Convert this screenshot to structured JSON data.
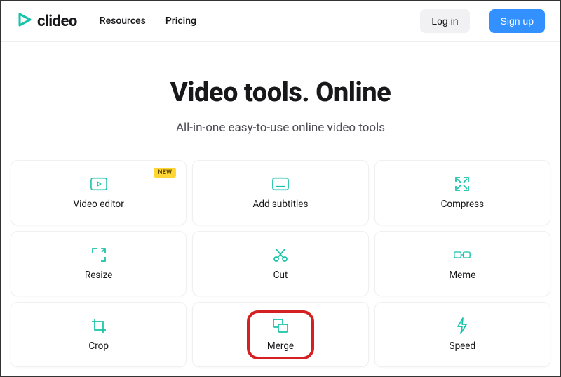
{
  "header": {
    "brand": "clideo",
    "nav": [
      "Resources",
      "Pricing"
    ],
    "login": "Log in",
    "signup": "Sign up"
  },
  "hero": {
    "title": "Video tools. Online",
    "subtitle": "All-in-one easy-to-use online video tools"
  },
  "badges": {
    "new": "NEW"
  },
  "tools": [
    {
      "label": "Video editor",
      "id": "video-editor",
      "new": true
    },
    {
      "label": "Add subtitles",
      "id": "add-subtitles"
    },
    {
      "label": "Compress",
      "id": "compress"
    },
    {
      "label": "Resize",
      "id": "resize"
    },
    {
      "label": "Cut",
      "id": "cut"
    },
    {
      "label": "Meme",
      "id": "meme"
    },
    {
      "label": "Crop",
      "id": "crop"
    },
    {
      "label": "Merge",
      "id": "merge",
      "highlighted": true
    },
    {
      "label": "Speed",
      "id": "speed"
    }
  ],
  "colors": {
    "accent_teal": "#16c2a8",
    "blue_primary": "#3391ff",
    "badge_yellow": "#ffd633",
    "highlight_red": "#d42020"
  }
}
